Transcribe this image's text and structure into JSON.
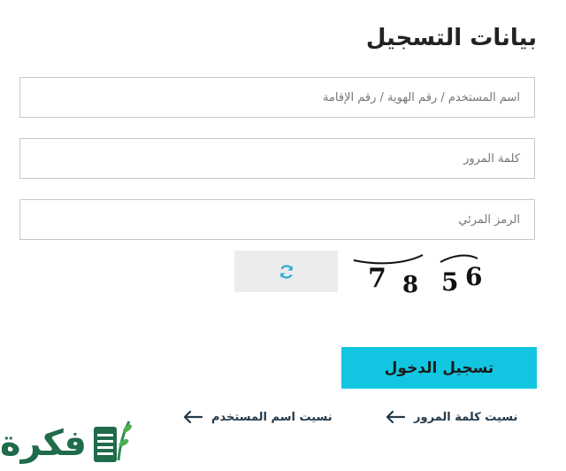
{
  "form": {
    "title": "بيانات التسجيل",
    "username_placeholder": "اسم المستخدم / رقم الهوية / رقم الإقامة",
    "password_placeholder": "كلمة المرور",
    "captcha_placeholder": "الرمز المرئي",
    "captcha_digits": [
      "7",
      "8",
      "5",
      "6"
    ],
    "login_label": "تسجيل الدخول",
    "forgot_password": "نسيت كلمة المرور",
    "forgot_username": "نسيت اسم المستخدم"
  },
  "brand": {
    "logo_text": "فكرة"
  },
  "icons": {
    "refresh": "refresh-icon",
    "arrow": "arrow-left-icon",
    "logo": "book-leaf-icon"
  },
  "colors": {
    "accent": "#12c6e2",
    "refresh_icon": "#2aa9d6",
    "brand": "#1f6b4a"
  }
}
